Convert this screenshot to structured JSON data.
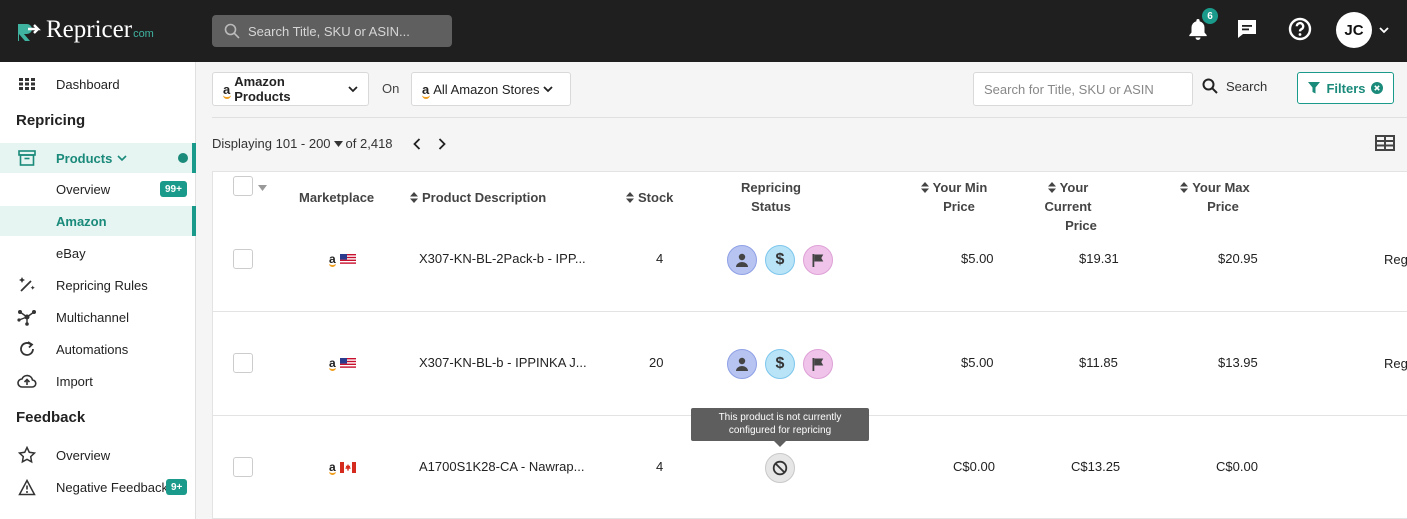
{
  "brand": {
    "name": "Repricer",
    "suffix": "com"
  },
  "topbar": {
    "search_placeholder": "Search Title, SKU or ASIN...",
    "notifications_count": "6",
    "user_initials": "JC"
  },
  "sidebar": {
    "dashboard": "Dashboard",
    "section_repricing": "Repricing",
    "products": "Products",
    "overview": "Overview",
    "overview_badge": "99+",
    "amazon": "Amazon",
    "ebay": "eBay",
    "repricing_rules": "Repricing Rules",
    "multichannel": "Multichannel",
    "automations": "Automations",
    "import": "Import",
    "section_feedback": "Feedback",
    "feedback_overview": "Overview",
    "negative_feedback": "Negative Feedback",
    "negative_badge": "9+"
  },
  "toolbar": {
    "product_source_logo": "a",
    "product_source": "Amazon Products",
    "on_label": "On",
    "store_logo": "a",
    "store": "All Amazon Stores",
    "search_placeholder": "Search for Title, SKU or ASIN",
    "search_label": "Search",
    "filters_label": "Filters"
  },
  "pagination": {
    "prefix": "Displaying",
    "range": "101 - 200",
    "of_total": "of 2,418"
  },
  "table": {
    "headers": {
      "marketplace": "Marketplace",
      "product_description": "Product Description",
      "stock": "Stock",
      "repricing_status_1": "Repricing",
      "repricing_status_2": "Status",
      "min_price_1": "Your Min",
      "min_price_2": "Price",
      "current_price_1": "Your Current",
      "current_price_2": "Price",
      "max_price_1": "Your Max",
      "max_price_2": "Price"
    },
    "rows": [
      {
        "marketplace_logo": "a",
        "country": "US",
        "description": "X307-KN-BL-2Pack-b - IPP...",
        "stock": "4",
        "status": "configured",
        "min_price": "$5.00",
        "current_price": "$19.31",
        "max_price": "$20.95",
        "extra": "Reg"
      },
      {
        "marketplace_logo": "a",
        "country": "US",
        "description": "X307-KN-BL-b - IPPINKA J...",
        "stock": "20",
        "status": "configured",
        "min_price": "$5.00",
        "current_price": "$11.85",
        "max_price": "$13.95",
        "extra": "Reg"
      },
      {
        "marketplace_logo": "a",
        "country": "CA",
        "description": "A1700S1K28-CA - Nawrap...",
        "stock": "4",
        "status": "not-configured",
        "min_price": "C$0.00",
        "current_price": "C$13.25",
        "max_price": "C$0.00",
        "extra": ""
      }
    ],
    "tooltip_line1": "This product is not currently",
    "tooltip_line2": "configured for repricing"
  },
  "colors": {
    "accent": "#1a9a8a",
    "topbar": "#1f1f1f"
  }
}
